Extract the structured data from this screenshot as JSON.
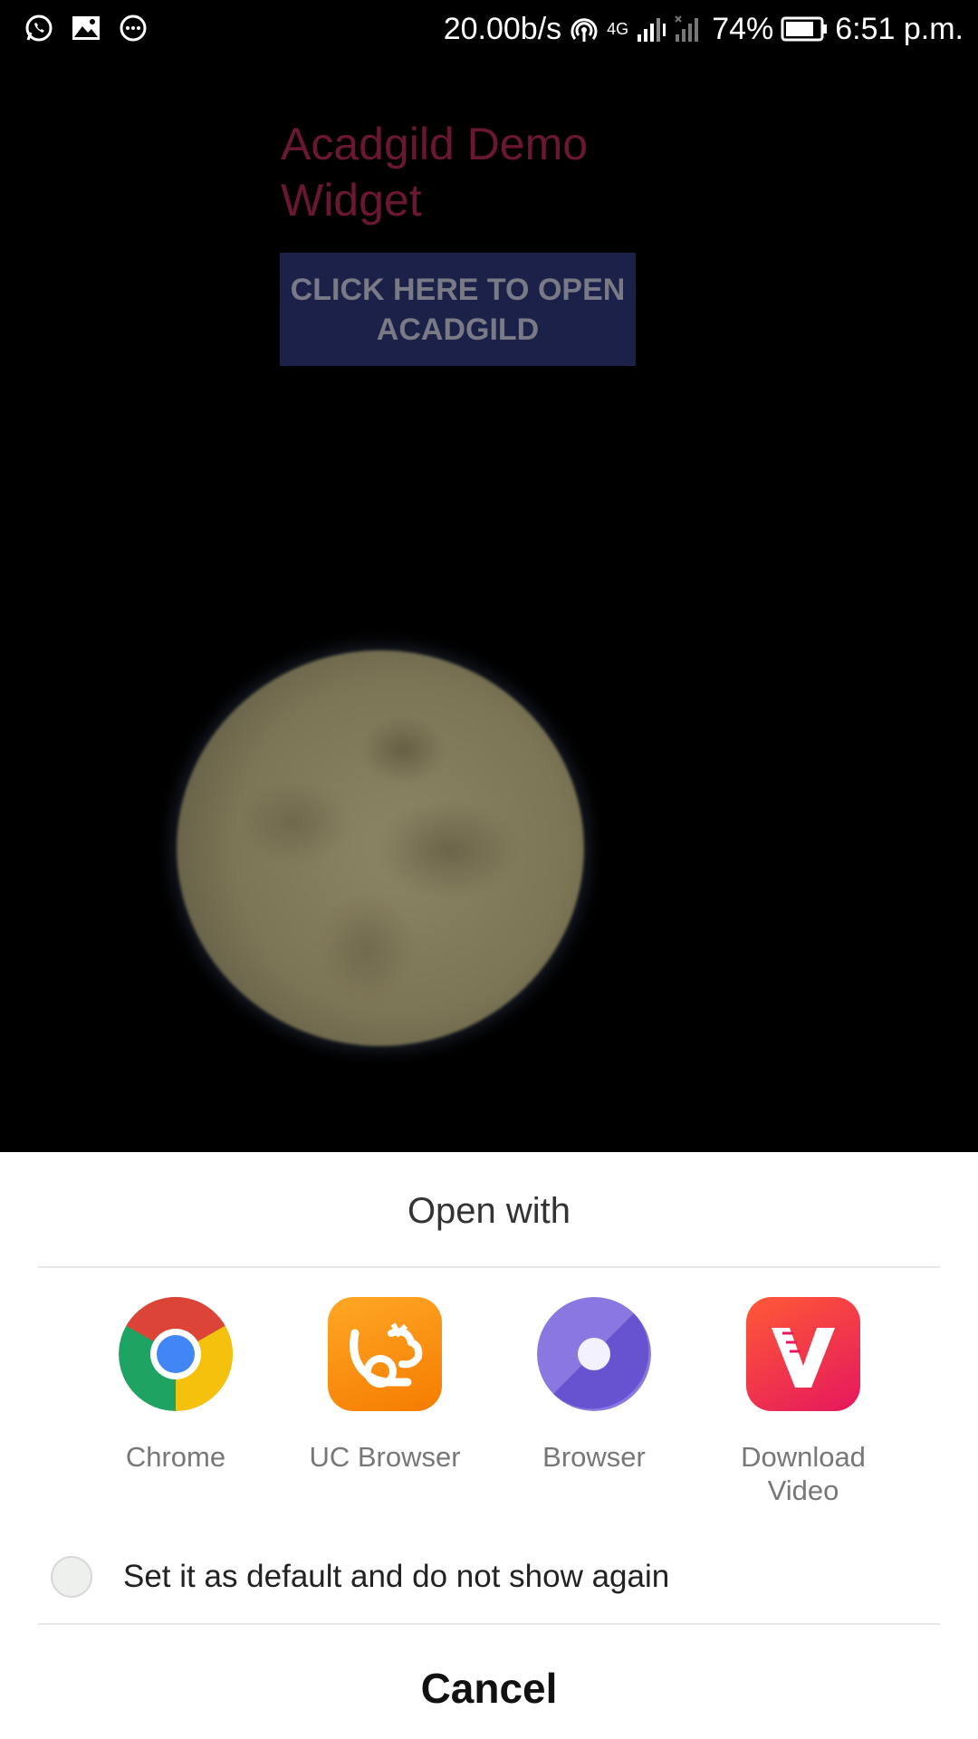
{
  "status_bar": {
    "net_speed": "20.00b/s",
    "network_type": "4G",
    "battery": "74%",
    "time": "6:51 p.m.",
    "left_icons": [
      "whatsapp-icon",
      "gallery-icon",
      "message-icon"
    ],
    "right_icons": [
      "hotspot-icon",
      "signal-icon",
      "no-signal-icon",
      "battery-icon"
    ]
  },
  "widget": {
    "title": "Acadgild Demo Widget",
    "button_label": "CLICK HERE TO OPEN ACADGILD"
  },
  "sheet": {
    "title": "Open with",
    "apps": [
      {
        "label": "Chrome",
        "icon": "chrome-icon"
      },
      {
        "label": "UC Browser",
        "icon": "uc-browser-icon"
      },
      {
        "label": "Browser",
        "icon": "browser-icon"
      },
      {
        "label": "Download Video",
        "icon": "download-video-icon"
      }
    ],
    "default_checkbox_label": "Set it as default and do not show again",
    "cancel_label": "Cancel"
  }
}
